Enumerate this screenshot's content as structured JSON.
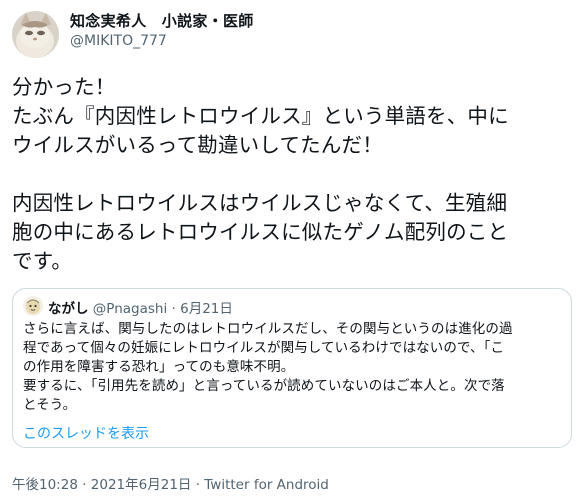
{
  "author": {
    "display_name": "知念実希人　小説家・医師",
    "handle": "@MIKITO_777",
    "avatar_icon": "cat-avatar-icon"
  },
  "tweet": {
    "lines": [
      "分かった！",
      "たぶん『内因性レトロウイルス』という単語を、中に",
      "ウイルスがいるって勘違いしてたんだ！",
      "",
      "内因性レトロウイルスはウイルスじゃなくて、生殖細",
      "胞の中にあるレトロウイルスに似たゲノム配列のこと",
      "です。"
    ]
  },
  "quoted_tweet": {
    "author_name": "ながし",
    "handle": "@Pnagashi",
    "separator": "·",
    "date": "6月21日",
    "avatar_icon": "quoted-user-avatar-icon",
    "lines": [
      "さらに言えば、関与したのはレトロウイルスだし、その関与というのは進化の過",
      "程であって個々の妊娠にレトロウイルスが関与しているわけではないので、「こ",
      "の作用を障害する恐れ」ってのも意味不明。",
      "要するに、「引用先を読め」と言っているが読めていないのはご本人と。次で落",
      "とそう。"
    ],
    "show_thread": "このスレッドを表示"
  },
  "timestamp": "午後10:28 · 2021年6月21日 · Twitter for Android",
  "colors": {
    "link": "#1d9bf0",
    "secondary": "#536471",
    "border": "#cfd9de"
  }
}
